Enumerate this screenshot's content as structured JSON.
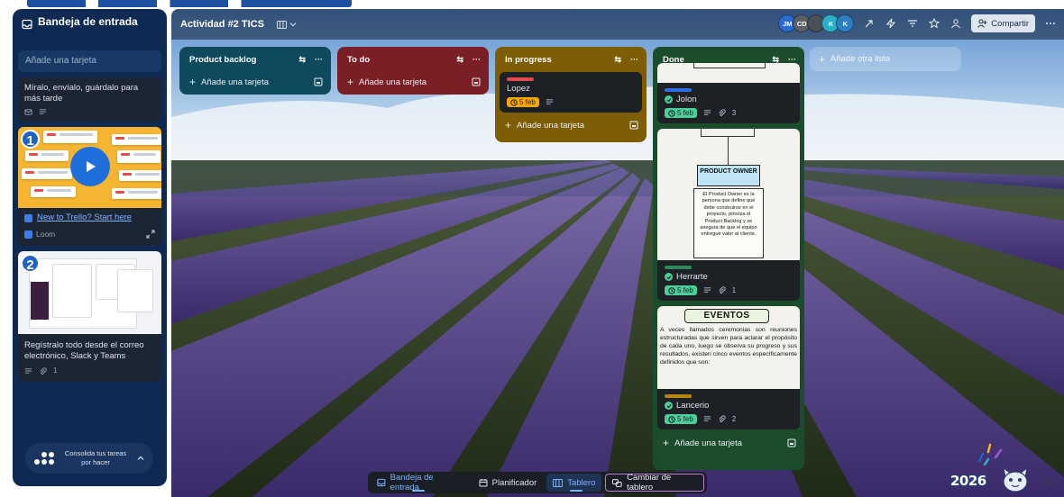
{
  "inbox": {
    "title": "Bandeja de entrada",
    "add_card_placeholder": "Añade una tarjeta",
    "cards": [
      {
        "text": "Míralo, envíalo, guárdalo para más tarde"
      },
      {
        "badge": "1",
        "link_text": "New to Trello? Start here",
        "source": "Loom"
      },
      {
        "badge": "2",
        "text": "Regístralo todo desde el correo electrónico, Slack y Teams",
        "attachments": "1"
      }
    ],
    "consolidate_text": "Consolida tus tareas por hacer"
  },
  "board": {
    "title": "Actividad #2 TICS",
    "avatars": [
      {
        "initials": "JM",
        "color": "#2b6ad1"
      },
      {
        "initials": "CD",
        "color": "#5b5f66"
      },
      {
        "initials": "",
        "color": "#4a4f58"
      },
      {
        "initials": "K",
        "color": "#2ab0c9"
      },
      {
        "initials": "K",
        "color": "#2d7fc1"
      }
    ],
    "share_label": "Compartir",
    "add_list_label": "Añade otra lista",
    "add_card_label": "Añade una tarjeta",
    "lists": [
      {
        "name": "Product backlog",
        "color": "#0e4a5c"
      },
      {
        "name": "To do",
        "color": "#7a1f25"
      },
      {
        "name": "In progress",
        "color": "#7d5d06",
        "cards": [
          {
            "title": "Lopez",
            "label_color": "#e5484d",
            "due": "5 feb"
          }
        ]
      },
      {
        "name": "Done",
        "color": "#1b4c2b",
        "cards": [
          {
            "title": "Jolon",
            "label_color": "#2f6fe0",
            "due": "5 feb",
            "attachments": "3"
          },
          {
            "title": "Herrarte",
            "label_color": "#2e8b57",
            "due": "5 feb",
            "attachments": "1",
            "cover_title": "PRODUCT OWNER",
            "cover_text": "El Product Owner es la persona que define qué debe construirse en el proyecto, prioriza el Product Backlog y se asegura de que el equipo entregue valor al cliente."
          },
          {
            "title": "Lancerio",
            "label_color": "#b8860b",
            "due": "5 feb",
            "attachments": "2",
            "cover_title": "EVENTOS",
            "cover_text": "A veces llamados ceremonias son reuniones estructuradas que sirven para aclarar el propósito de cada uno, luego se observa su progreso y sus resultados, existen cinco eventos específicamente definidos que son:"
          }
        ]
      }
    ]
  },
  "switcher": {
    "inbox": "Bandeja de entrada",
    "planner": "Planificador",
    "board": "Tablero",
    "change": "Cambiar de tablero"
  },
  "year_badge": "2026"
}
